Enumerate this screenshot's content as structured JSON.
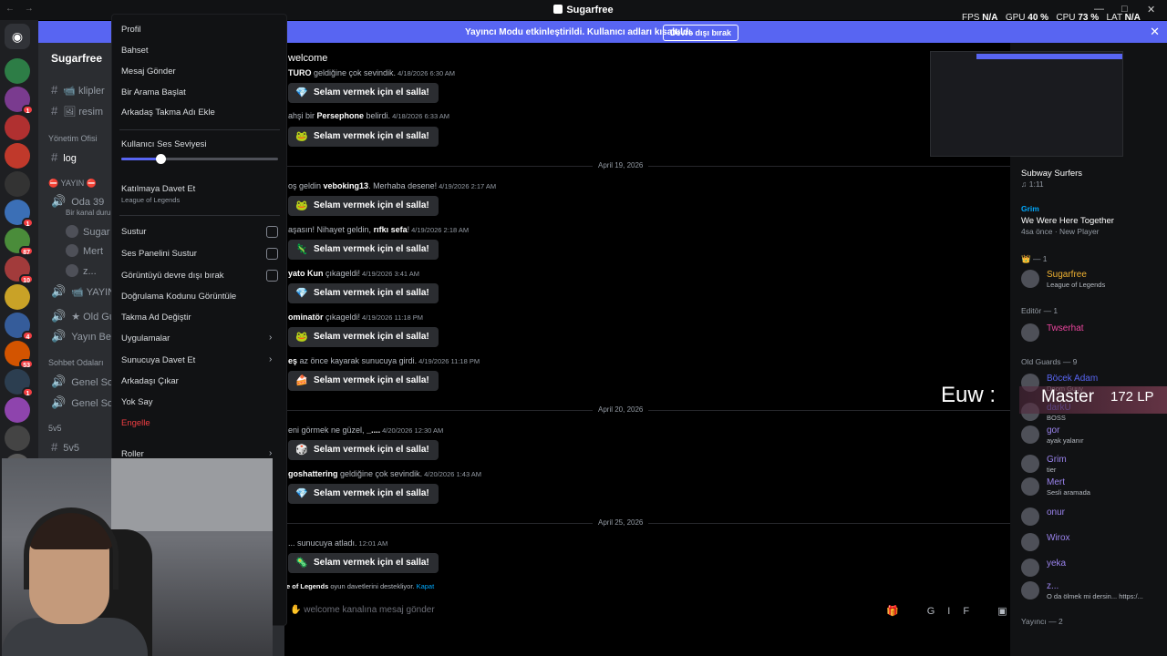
{
  "titlebar": {
    "nav": "←  →",
    "title": "Sugarfree",
    "minimize": "—",
    "maximize": "□",
    "close": "✕"
  },
  "perf": {
    "fps_label": "FPS",
    "fps": "N/A",
    "gpu_label": "GPU",
    "gpu": "40 %",
    "cpu_label": "CPU",
    "cpu": "73 %",
    "lat_label": "LAT",
    "lat": "N/A"
  },
  "banner": {
    "message": "Yayıncı Modu etkinleştirildi. Kullanıcı adları kısaltıldı.",
    "button": "Devre dışı bırak",
    "close": "✕"
  },
  "servers": [
    {
      "badge": ""
    },
    {
      "badge": "1"
    },
    {
      "badge": ""
    },
    {
      "badge": ""
    },
    {
      "badge": ""
    },
    {
      "badge": "1"
    },
    {
      "badge": "87"
    },
    {
      "badge": "10"
    },
    {
      "badge": ""
    },
    {
      "badge": "4"
    },
    {
      "badge": "53"
    },
    {
      "badge": "1"
    },
    {
      "badge": ""
    },
    {
      "badge": ""
    },
    {
      "badge": ""
    }
  ],
  "home_icon": "◉",
  "channels": {
    "guild": "Sugarfree",
    "items": [
      {
        "kind": "chn",
        "icon": "#",
        "label": "klipler",
        "emoji": "📹"
      },
      {
        "kind": "chn",
        "icon": "#",
        "label": "resim",
        "emoji": "🖼"
      },
      {
        "kind": "cat",
        "label": "Yönetim Ofisi"
      },
      {
        "kind": "chn",
        "icon": "#",
        "label": "log"
      },
      {
        "kind": "cat",
        "label": "⛔ YAYIN ⛔"
      },
      {
        "kind": "chn",
        "icon": "🔊",
        "label": "Oda 39"
      },
      {
        "kind": "sub",
        "label": "Bir kanal duru"
      },
      {
        "kind": "usr",
        "label": "Sugar"
      },
      {
        "kind": "usr",
        "label": "Mert"
      },
      {
        "kind": "usr",
        "label": "z..."
      },
      {
        "kind": "chn",
        "icon": "🔊",
        "label": "📹 YAYINN"
      },
      {
        "kind": "chn",
        "icon": "🔊",
        "label": "★ Old Guar"
      },
      {
        "kind": "chn",
        "icon": "🔊",
        "label": "Yayın Bekle"
      },
      {
        "kind": "cat",
        "label": "Sohbet Odaları"
      },
      {
        "kind": "chn",
        "icon": "🔊",
        "label": "Genel Sohb"
      },
      {
        "kind": "chn",
        "icon": "🔊",
        "label": "Genel Sohb"
      },
      {
        "kind": "cat",
        "label": "5v5"
      },
      {
        "kind": "chn",
        "icon": "#",
        "label": "5v5"
      }
    ]
  },
  "menu": {
    "items": [
      "Profil",
      "Bahset",
      "Mesaj Gönder",
      "Bir Arama Başlat",
      "Arkadaş Takma Adı Ekle"
    ],
    "volume_label": "Kullanıcı Ses Seviyesi",
    "volume_value": 0.25,
    "invite_label": "Katılmaya Davet Et",
    "invite_sub": "League of Legends",
    "checks": [
      "Sustur",
      "Ses Panelini Sustur",
      "Görüntüyü devre dışı bırak"
    ],
    "more": [
      "Doğrulama Kodunu Görüntüle",
      "Takma Ad Değiştir"
    ],
    "submenus": [
      "Uygulamalar",
      "Sunucuya Davet Et"
    ],
    "tail": [
      "Arkadaşı Çıkar",
      "Yok Say"
    ],
    "danger": "Engelle",
    "roles": "Roller"
  },
  "chat": {
    "channel": "welcome",
    "wave_label": "Selam vermek için el salla!",
    "dates": [
      "April 19, 2026",
      "April 20, 2026",
      "April 25, 2026"
    ],
    "messages": [
      {
        "pre": "",
        "name": "TURO",
        "post": " geldiğine çok sevindik.",
        "ts": "4/18/2026 6:30 AM"
      },
      {
        "pre": "ahşi bir ",
        "name": "Persephone",
        "post": " belirdi.",
        "ts": "4/18/2026 6:33 AM"
      },
      {
        "pre": "oş geldin ",
        "name": "veboking13",
        "post": ". Merhaba desene!",
        "ts": "4/19/2026 2:17 AM"
      },
      {
        "pre": "aşasın! Nihayet geldin, ",
        "name": "rıfkı sefa",
        "post": "!",
        "ts": "4/19/2026 2:18 AM"
      },
      {
        "pre": "",
        "name": "yato Kun",
        "post": " çıkageldi!",
        "ts": "4/19/2026 3:41 AM"
      },
      {
        "pre": "",
        "name": "ominatör",
        "post": " çıkageldi!",
        "ts": "4/19/2026 11:18 PM"
      },
      {
        "pre": "",
        "name": "eş",
        "post": " az önce kayarak sunucuya girdi.",
        "ts": "4/19/2026 11:18 PM"
      },
      {
        "pre": "eni görmek ne güzel, ",
        "name": "_....",
        "post": "",
        "ts": "4/20/2026 12:30 AM"
      },
      {
        "pre": "",
        "name": "goshattering",
        "post": " geldiğine çok sevindik.",
        "ts": "4/20/2026 1:43 AM"
      },
      {
        "pre": "... sunucuya atladı.",
        "name": "",
        "post": "",
        "ts": "12:01 AM"
      }
    ],
    "hint_bold": "e of Legends",
    "hint_text": " oyun davetlerini destekliyor. ",
    "hint_link": "Kapat",
    "composer": "welcome kanalına mesaj gönder",
    "composer_icons": "🎁 GIF ▣ ☺ ✥"
  },
  "members": {
    "activity": [
      {
        "name": "Subway Surfers",
        "sub": "♫ 1:11"
      },
      {
        "name": "We Were Here Together",
        "sub": "4sa önce · New Player",
        "user": "Grim"
      }
    ],
    "cats": [
      "👑 — 1",
      "Editör — 1",
      "Old Guards — 9",
      "Yayıncı — 2"
    ],
    "owner": {
      "name": "Sugarfree",
      "sub": "League of Legends"
    },
    "editor": {
      "name": "Twserhat"
    },
    "old_guards": [
      {
        "name": "Böcek Adam",
        "sub": "Doom Guuy"
      },
      {
        "name": "darkU",
        "sub": "BOSS"
      },
      {
        "name": "gor",
        "sub": "ayak yalanır"
      },
      {
        "name": "Grim",
        "sub": "tier"
      },
      {
        "name": "Mert",
        "sub": "Sesli aramada"
      },
      {
        "name": "onur",
        "sub": ""
      },
      {
        "name": "Wirox",
        "sub": ""
      },
      {
        "name": "yeka",
        "sub": ""
      },
      {
        "name": "z...",
        "sub": "O da ölmek mi dersin... https:/..."
      }
    ],
    "overlay_region": "Euw :",
    "overlay_rank": "Master",
    "overlay_lp": "172 LP"
  },
  "colors": {
    "accent": "#5865f2",
    "danger": "#f23f43",
    "green": "#23a55a"
  }
}
